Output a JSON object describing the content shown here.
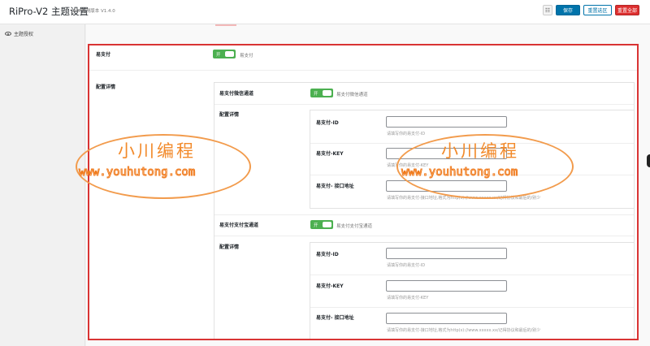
{
  "header": {
    "app_title": "RiPro-V2 主题设置",
    "version": "SVIP内测版本 V1.4.0",
    "grid_label": "☷",
    "save_label": "保存",
    "reset_section_label": "重置选区",
    "reset_all_label": "重置全部"
  },
  "sidebar": {
    "items": [
      {
        "label": "主题授权",
        "icon": "eye-icon"
      }
    ]
  },
  "settings": {
    "master": {
      "label": "易支付",
      "switch_text": "开",
      "desc": "易支付"
    },
    "config_label": "配置详情",
    "channels": [
      {
        "label": "易支付微信通道",
        "switch_text": "开",
        "desc": "易支付微信通道",
        "config_label": "配置详情",
        "fields": [
          {
            "label": "易支付-ID",
            "value": "",
            "hint": "请填写你的易支付-ID"
          },
          {
            "label": "易支付-KEY",
            "value": "",
            "hint": "请填写你的易支付-KEY"
          },
          {
            "label": "易支付- 接口地址",
            "value": "",
            "hint": "请填写你的易支付-接口地址,格式为http(s)://www.xxxxx.xx/记得协议和最后的/别少"
          }
        ]
      },
      {
        "label": "易支付支付宝通道",
        "switch_text": "开",
        "desc": "易支付支付宝通道",
        "config_label": "配置详情",
        "fields": [
          {
            "label": "易支付-ID",
            "value": "",
            "hint": "请填写你的易支付-ID"
          },
          {
            "label": "易支付-KEY",
            "value": "",
            "hint": "请填写你的易支付-KEY"
          },
          {
            "label": "易支付- 接口地址",
            "value": "",
            "hint": "请填写你的易支付-接口地址,格式为http(s)://www.xxxxx.xx/记得协议和最后的/别少"
          }
        ]
      }
    ]
  },
  "watermark": {
    "title": "小川编程",
    "url": "www.youhutong.com"
  },
  "colors": {
    "accent": "#0073aa",
    "danger": "#dd2f2f",
    "switch_on": "#4cb050",
    "highlight_box": "#d93434",
    "watermark": "#f28a2b"
  }
}
